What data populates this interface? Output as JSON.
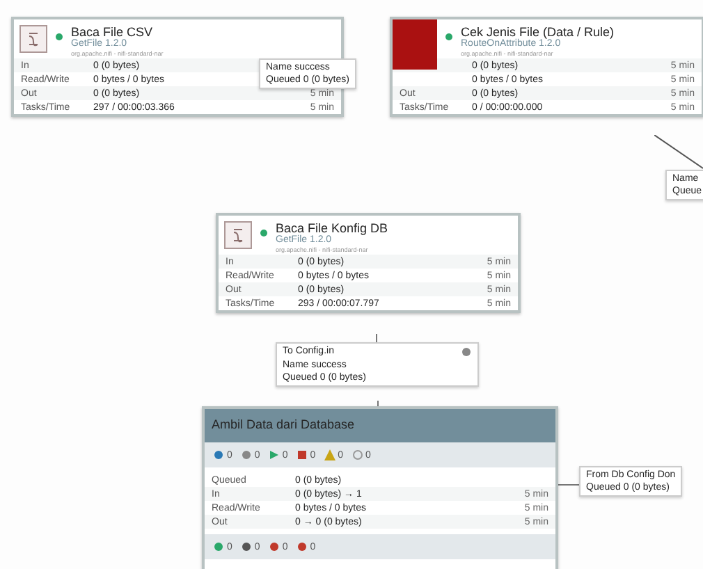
{
  "processors": [
    {
      "name": "Baca File CSV",
      "type": "GetFile 1.2.0",
      "bundle": "org.apache.nifi - nifi-standard-nar",
      "running": true,
      "kind": "processor",
      "rows": [
        {
          "label": "In",
          "value": "0 (0 bytes)"
        },
        {
          "label": "Read/Write",
          "value": "0 bytes / 0 bytes"
        },
        {
          "label": "Out",
          "value": "0 (0 bytes)",
          "time": "5 min"
        },
        {
          "label": "Tasks/Time",
          "value": "297 / 00:00:03.366",
          "time": "5 min"
        }
      ]
    },
    {
      "name": "Cek Jenis File (Data / Rule)",
      "type": "RouteOnAttribute 1.2.0",
      "bundle": "org.apache.nifi - nifi-standard-nar",
      "running": true,
      "kind": "invalid",
      "rows": [
        {
          "value": "0 (0 bytes)",
          "time": "5 min"
        },
        {
          "value": "0 bytes / 0 bytes",
          "time": "5 min"
        },
        {
          "label": "Out",
          "value": "0 (0 bytes)",
          "time": "5 min"
        },
        {
          "label": "Tasks/Time",
          "value": "0 / 00:00:00.000",
          "time": "5 min"
        }
      ]
    },
    {
      "name": "Baca File Konfig DB",
      "type": "GetFile 1.2.0",
      "bundle": "org.apache.nifi - nifi-standard-nar",
      "running": true,
      "kind": "processor",
      "rows": [
        {
          "label": "In",
          "value": "0 (0 bytes)",
          "time": "5 min"
        },
        {
          "label": "Read/Write",
          "value": "0 bytes / 0 bytes",
          "time": "5 min"
        },
        {
          "label": "Out",
          "value": "0 (0 bytes)",
          "time": "5 min"
        },
        {
          "label": "Tasks/Time",
          "value": "293 / 00:00:07.797",
          "time": "5 min"
        }
      ]
    }
  ],
  "connections": [
    {
      "lines": [
        {
          "label": "Name",
          "value": "success"
        },
        {
          "label": "Queued",
          "value": "0 (0 bytes)"
        }
      ]
    },
    {
      "lines": [
        {
          "label": "Name"
        },
        {
          "label": "Queue"
        }
      ]
    },
    {
      "title": "To Config.in",
      "lines": [
        {
          "label": "Name",
          "value": "success"
        },
        {
          "label": "Queued",
          "value": "0 (0 bytes)"
        }
      ]
    },
    {
      "lines": [
        {
          "label": "From",
          "value": "Db Config Don"
        },
        {
          "label": "Queued",
          "value": "0 (0 bytes)"
        }
      ]
    }
  ],
  "process_group": {
    "name": "Ambil Data dari Database",
    "status": [
      {
        "kind": "transmitting",
        "count": "0"
      },
      {
        "kind": "not-transmitting",
        "count": "0"
      },
      {
        "kind": "running",
        "count": "0"
      },
      {
        "kind": "stopped",
        "count": "0"
      },
      {
        "kind": "invalid",
        "count": "0"
      },
      {
        "kind": "disabled",
        "count": "0"
      }
    ],
    "rows": [
      {
        "label": "Queued",
        "value": "0 (0 bytes)"
      },
      {
        "label": "In",
        "value": "0 (0 bytes) → 1",
        "time": "5 min"
      },
      {
        "label": "Read/Write",
        "value": "0 bytes / 0 bytes",
        "time": "5 min"
      },
      {
        "label": "Out",
        "value": "0 → 0 (0 bytes)",
        "time": "5 min"
      }
    ],
    "versions": [
      {
        "kind": "up-to-date",
        "count": "0"
      },
      {
        "kind": "modified",
        "count": "0"
      },
      {
        "kind": "stale",
        "count": "0"
      },
      {
        "kind": "error",
        "count": "0"
      }
    ]
  }
}
